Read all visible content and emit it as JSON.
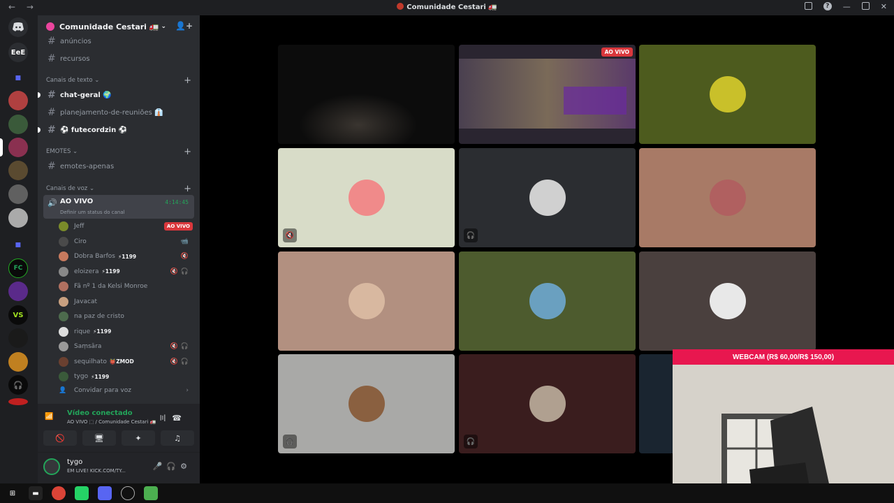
{
  "window": {
    "title": "Comunidade Cestari 🚛",
    "nav": "← →"
  },
  "rail": {
    "text_server": "EeE"
  },
  "server": {
    "name": "Comunidade Cestari 🚛"
  },
  "channels": {
    "top": [
      {
        "name": "anúncios"
      },
      {
        "name": "recursos"
      }
    ],
    "text_category": "Canais de texto",
    "text": [
      {
        "name": "chat-geral 🌍"
      },
      {
        "name": "planejamento-de-reuniões 👔"
      },
      {
        "name": "⚽ futecordzin ⚽"
      }
    ],
    "emotes_category": "EMOTES",
    "emotes": [
      {
        "name": "emotes-apenas"
      }
    ],
    "voice_category": "Canais de voz",
    "voice_channel": {
      "name": "AO VIVO",
      "timer": "4:14:45",
      "status": "Definir um status do canal"
    },
    "voice_users": [
      {
        "name": "Jeff",
        "badge": "AO VIVO",
        "color": "#7a8b2a"
      },
      {
        "name": "Ciro",
        "icons": "📹",
        "color": "#4a4a4a"
      },
      {
        "name": "Dobra Barfos",
        "tag": "⚡1199",
        "icons": "🔇",
        "color": "#c77a5e"
      },
      {
        "name": "eloizera",
        "tag": "⚡1199",
        "icons": "🔇🎧",
        "color": "#888"
      },
      {
        "name": "Fã nº 1 da Kelsi Monroe",
        "color": "#b07060"
      },
      {
        "name": "Javacat",
        "color": "#c8a080"
      },
      {
        "name": "na paz de cristo",
        "color": "#4d6b4d"
      },
      {
        "name": "rique",
        "tag": "⚡1199",
        "color": "#ddd"
      },
      {
        "name": "Saṃsāra",
        "icons": "🔇🎧",
        "color": "#999"
      },
      {
        "name": "sequilhato",
        "tag": "👹ZMOD",
        "icons": "🔇🎧",
        "color": "#6a4030"
      },
      {
        "name": "tygo",
        "tag": "⚡1199",
        "color": "#3a5a3a"
      }
    ],
    "invite_voice": "Convidar para voz"
  },
  "voice_connected": {
    "title": "Vídeo conectado",
    "subtitle": "AO VIVO ⬚ / Comunidade Cestari 🚛"
  },
  "user": {
    "name": "tygo",
    "status": "EM LIVE! KICK.COM/TY..."
  },
  "video_tiles": [
    {
      "bg": "#0c0c0c",
      "avatar": ""
    },
    {
      "bg": "#2a2530",
      "avatar": "",
      "live": "AO VIVO"
    },
    {
      "bg": "#4d5b1e",
      "avatar": "#c9c02a"
    },
    {
      "bg": "#d8dcc8",
      "avatar": "#f08a8a",
      "mute": "🔇"
    },
    {
      "bg": "#2b2d31",
      "avatar": "#d0d0d0",
      "mute": "🎧"
    },
    {
      "bg": "#a87a66",
      "avatar": "#b06060"
    },
    {
      "bg": "#b29080",
      "avatar": "#d8b8a0"
    },
    {
      "bg": "#4d5b2e",
      "avatar": "#6aa0c0"
    },
    {
      "bg": "#4a403e",
      "avatar": "#e8e8e8"
    },
    {
      "bg": "#a9a9a7",
      "avatar": "#8a6040",
      "mute": "🎧"
    },
    {
      "bg": "#3a1d1e",
      "avatar": "#b0a090",
      "mute": "🎧"
    },
    {
      "bg": "#1a2530",
      "avatar": ""
    }
  ],
  "webcam": {
    "label": "WEBCAM (R$ 60,00/R$ 150,00)"
  }
}
